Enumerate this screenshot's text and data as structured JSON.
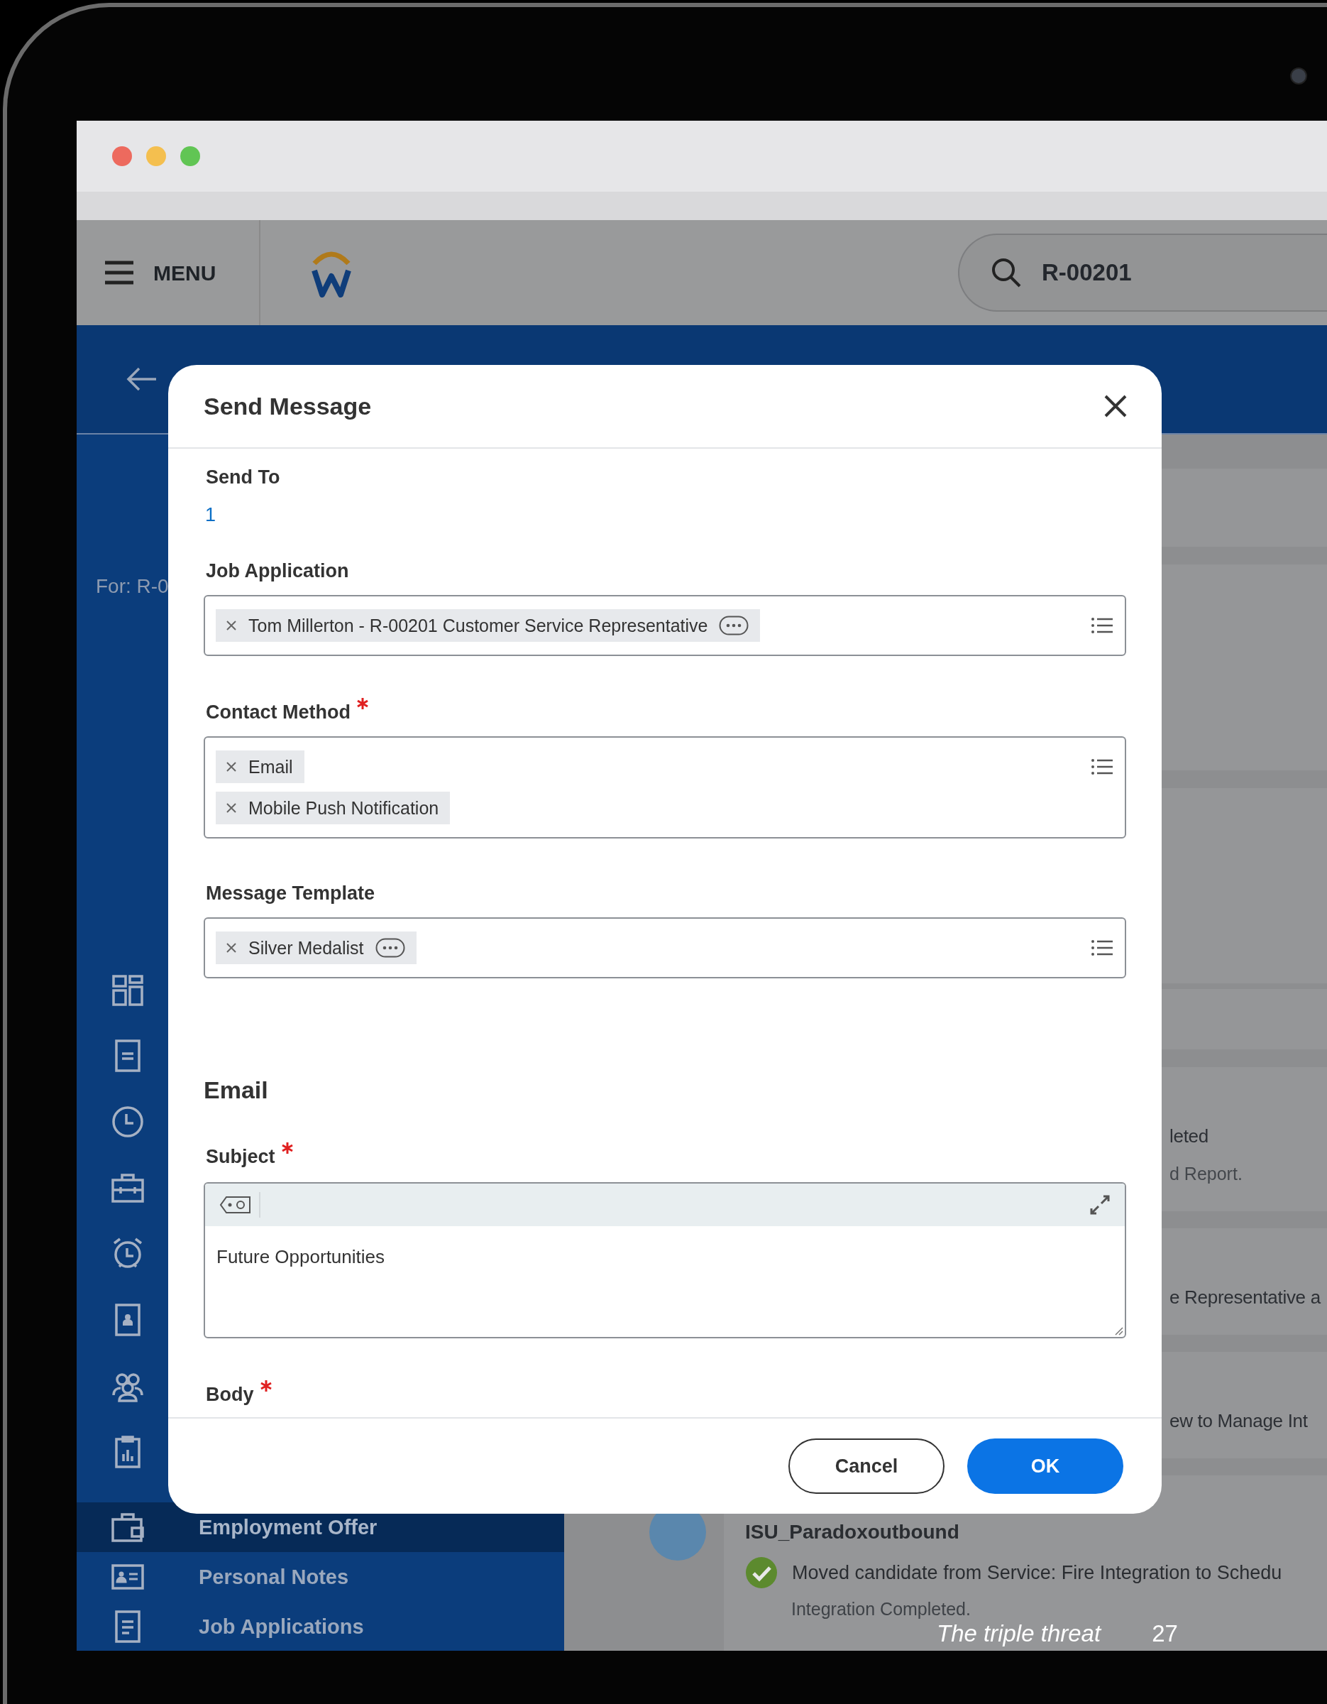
{
  "top_bar": {
    "menu_label": "MENU",
    "search_value": "R-00201"
  },
  "page": {
    "for_label": "For: R-0"
  },
  "sidebar": {
    "items": [
      {
        "label": "Employment Offer",
        "selected": true
      },
      {
        "label": "Personal Notes",
        "selected": false
      },
      {
        "label": "Job Applications",
        "selected": false
      }
    ]
  },
  "activity": [
    {
      "kind": "title",
      "text": "leted"
    },
    {
      "kind": "detail",
      "text": "d Report."
    },
    {
      "kind": "title",
      "text": "e Representative a"
    },
    {
      "kind": "title",
      "text": "ew to Manage Int"
    }
  ],
  "activity_entry": {
    "source": "ISU_Paradoxoutbound",
    "message": "Moved candidate from Service: Fire Integration to Schedu",
    "detail": "Integration Completed.",
    "completed": true
  },
  "dialog": {
    "title": "Send Message",
    "fields": [
      {
        "kind": "link",
        "label": "Send To",
        "required": false,
        "value": "1"
      },
      {
        "kind": "multiselect",
        "label": "Job Application",
        "required": false,
        "chips": [
          {
            "text": "Tom Millerton - R-00201 Customer Service Representative",
            "has_actions": true
          }
        ]
      },
      {
        "kind": "multiselect",
        "label": "Contact Method",
        "required": true,
        "chips": [
          {
            "text": "Email",
            "has_actions": false
          },
          {
            "text": "Mobile Push Notification",
            "has_actions": false
          }
        ]
      },
      {
        "kind": "multiselect",
        "label": "Message Template",
        "required": false,
        "chips": [
          {
            "text": "Silver Medalist",
            "has_actions": true
          }
        ]
      },
      {
        "kind": "section",
        "label": "Email"
      },
      {
        "kind": "richtext",
        "label": "Subject",
        "required": true,
        "value": "Future Opportunities"
      },
      {
        "kind": "label",
        "label": "Body",
        "required": true
      }
    ],
    "buttons": [
      {
        "label": "Cancel",
        "primary": false
      },
      {
        "label": "OK",
        "primary": true
      }
    ]
  },
  "slide_footer": {
    "title": "The triple threat",
    "page": "27"
  }
}
